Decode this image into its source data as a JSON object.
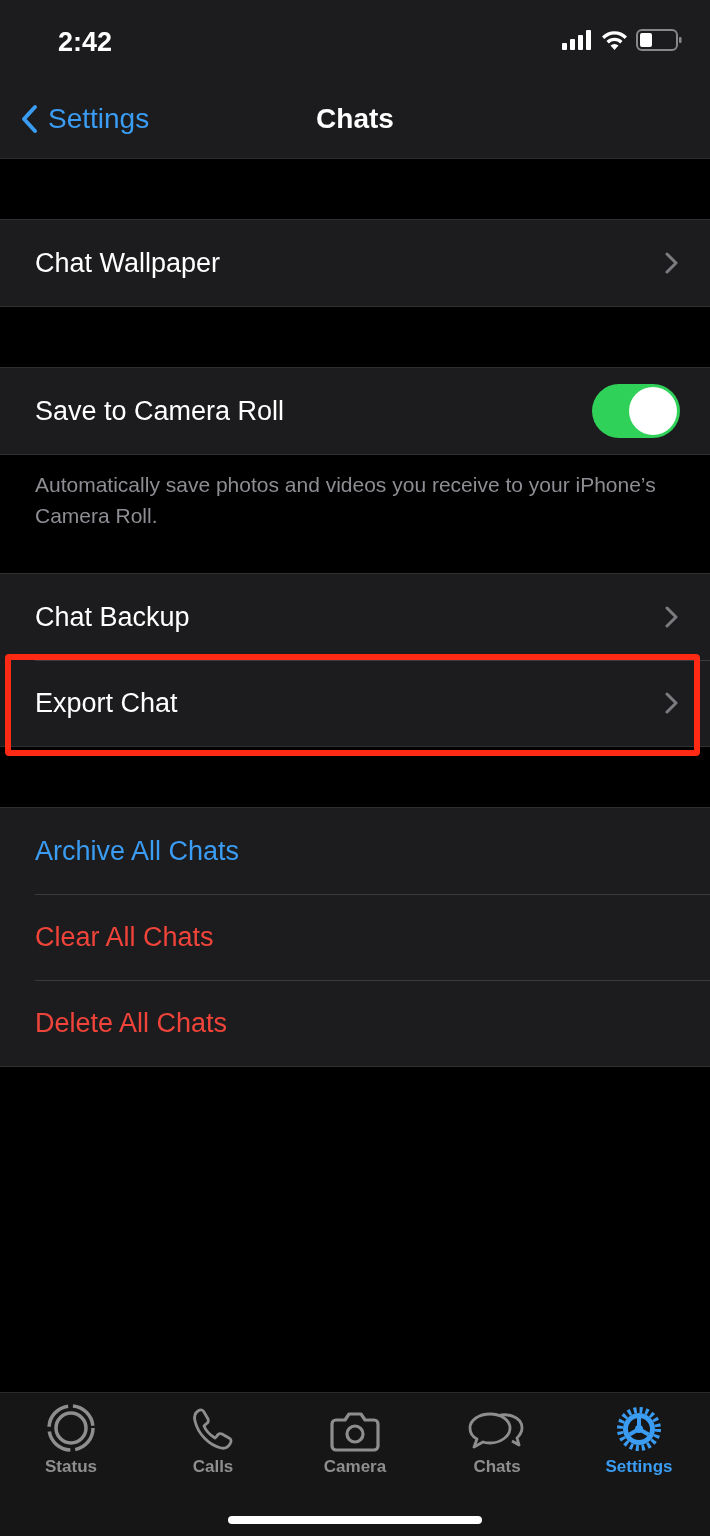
{
  "status_bar": {
    "time": "2:42"
  },
  "nav": {
    "back_label": "Settings",
    "title": "Chats"
  },
  "sections": [
    {
      "rows": [
        {
          "kind": "link",
          "label": "Chat Wallpaper",
          "highlighted": false
        }
      ]
    },
    {
      "rows": [
        {
          "kind": "toggle",
          "label": "Save to Camera Roll",
          "on": true
        }
      ],
      "footer": "Automatically save photos and videos you receive to your iPhone’s Camera Roll."
    },
    {
      "rows": [
        {
          "kind": "link",
          "label": "Chat Backup",
          "highlighted": false
        },
        {
          "kind": "link",
          "label": "Export Chat",
          "highlighted": true
        }
      ]
    },
    {
      "rows": [
        {
          "kind": "action",
          "label": "Archive All Chats",
          "color": "#3a9cf2"
        },
        {
          "kind": "action",
          "label": "Clear All Chats",
          "color": "#f0443a"
        },
        {
          "kind": "action",
          "label": "Delete All Chats",
          "color": "#f0443a"
        }
      ]
    }
  ],
  "tab_bar": [
    {
      "label": "Status",
      "selected": false
    },
    {
      "label": "Calls",
      "selected": false
    },
    {
      "label": "Camera",
      "selected": false
    },
    {
      "label": "Chats",
      "selected": false
    },
    {
      "label": "Settings",
      "selected": true
    }
  ]
}
